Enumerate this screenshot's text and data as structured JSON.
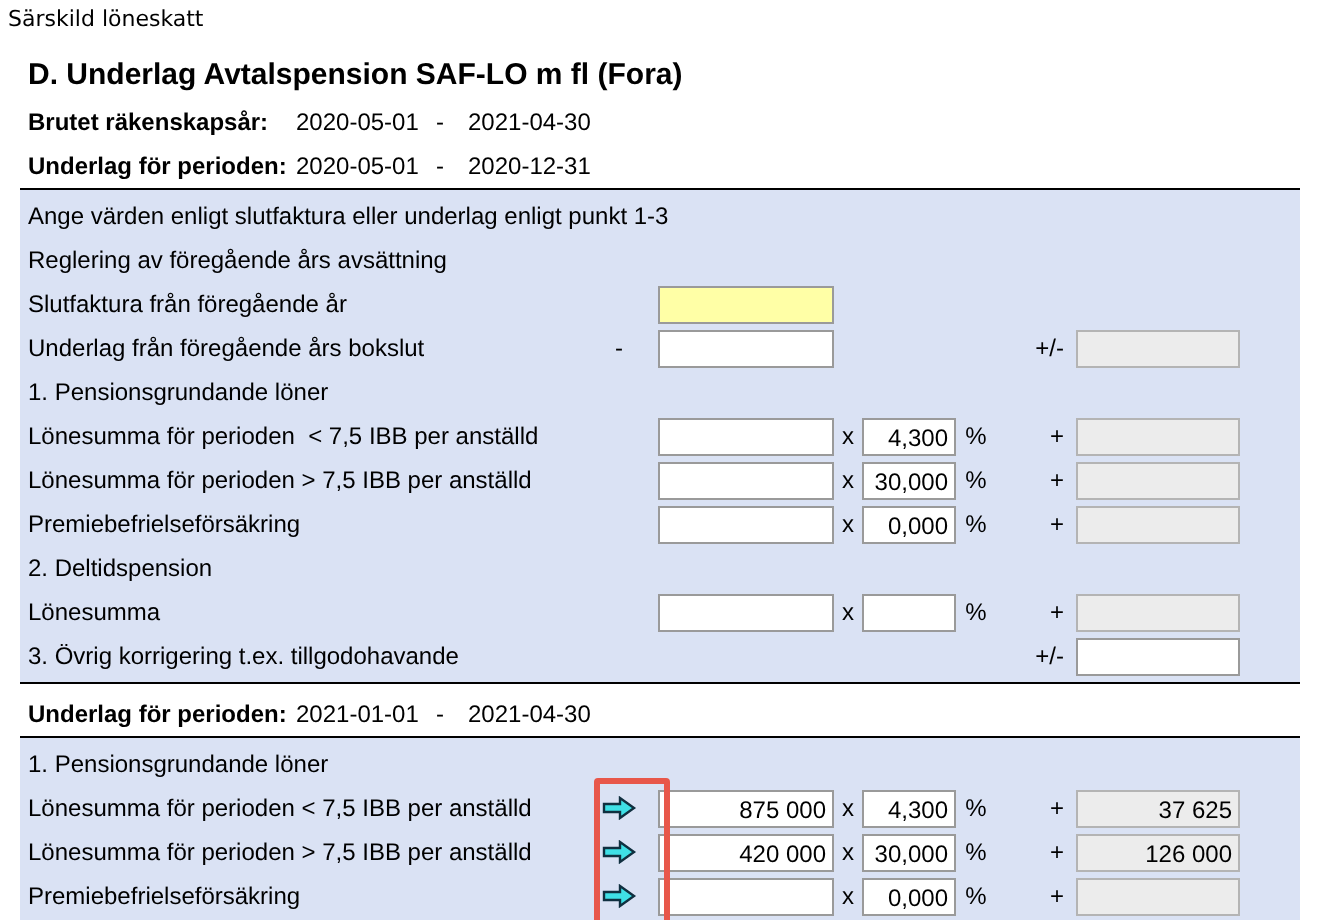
{
  "window": {
    "title": "Särskild löneskatt"
  },
  "heading": "D. Underlag Avtalspension SAF-LO m fl (Fora)",
  "fiscal_year": {
    "label": "Brutet räkenskapsår:",
    "from": "2020-05-01",
    "separator": "-",
    "to": "2021-04-30"
  },
  "sections": [
    {
      "period": {
        "label": "Underlag för perioden:",
        "from": "2020-05-01",
        "separator": "-",
        "to": "2020-12-31"
      },
      "rows": [
        {
          "kind": "text",
          "label": "Ange värden enligt slutfaktura eller underlag enligt punkt 1-3"
        },
        {
          "kind": "text",
          "label": "Reglering av föregående års avsättning"
        },
        {
          "kind": "entry",
          "label": "Slutfaktura från föregående år",
          "focused": true
        },
        {
          "kind": "entry",
          "label": "Underlag från föregående års bokslut",
          "sign": "-",
          "result_sign": "+/-",
          "result_editable": false,
          "focused": false
        },
        {
          "kind": "text",
          "label": "1. Pensionsgrundande löner"
        },
        {
          "kind": "calc",
          "label": "Lönesumma för perioden  < 7,5 IBB per anställd",
          "operator": "x",
          "rate": "4,300",
          "unit": "%",
          "result_sign": "+",
          "result_editable": false
        },
        {
          "kind": "calc",
          "label": "Lönesumma för perioden > 7,5 IBB per anställd",
          "operator": "x",
          "rate": "30,000",
          "unit": "%",
          "result_sign": "+",
          "result_editable": false
        },
        {
          "kind": "calc",
          "label": "Premiebefrielseförsäkring",
          "operator": "x",
          "rate": "0,000",
          "unit": "%",
          "result_sign": "+",
          "result_editable": false
        },
        {
          "kind": "text",
          "label": "2. Deltidspension"
        },
        {
          "kind": "calc",
          "label": "Lönesumma",
          "operator": "x",
          "unit": "%",
          "result_sign": "+",
          "result_editable": false
        },
        {
          "kind": "adjust",
          "label": "3. Övrig korrigering t.ex. tillgodohavande",
          "result_sign": "+/-",
          "result_editable": true
        }
      ]
    },
    {
      "period": {
        "label": "Underlag för perioden:",
        "from": "2021-01-01",
        "separator": "-",
        "to": "2021-04-30"
      },
      "arrows_highlighted": true,
      "rows": [
        {
          "kind": "text",
          "label": "1. Pensionsgrundande löner"
        },
        {
          "kind": "calc",
          "label": "Lönesumma för perioden < 7,5 IBB per anställd",
          "arrow": true,
          "amount": "875 000",
          "operator": "x",
          "rate": "4,300",
          "unit": "%",
          "result_sign": "+",
          "result": "37 625",
          "result_editable": false
        },
        {
          "kind": "calc",
          "label": "Lönesumma för perioden > 7,5 IBB per anställd",
          "arrow": true,
          "amount": "420 000",
          "operator": "x",
          "rate": "30,000",
          "unit": "%",
          "result_sign": "+",
          "result": "126 000",
          "result_editable": false
        },
        {
          "kind": "calc",
          "label": "Premiebefrielseförsäkring",
          "arrow": true,
          "operator": "x",
          "rate": "0,000",
          "unit": "%",
          "result_sign": "+",
          "result_editable": false
        }
      ]
    }
  ]
}
